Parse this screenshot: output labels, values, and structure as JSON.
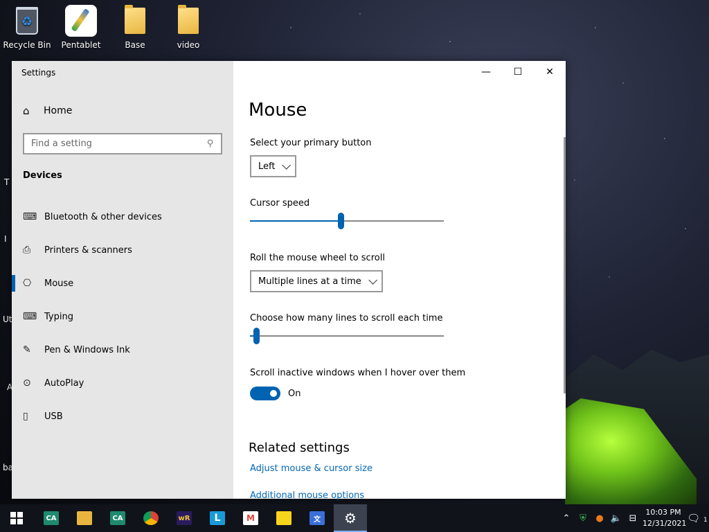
{
  "desktop": {
    "icons": [
      {
        "label": "Recycle Bin"
      },
      {
        "label": "Pentablet"
      },
      {
        "label": "Base"
      },
      {
        "label": "video"
      }
    ],
    "edge_letters": [
      "T",
      "I",
      "Ut",
      "A",
      "ba"
    ]
  },
  "window": {
    "title": "Settings",
    "controls": {
      "minimize": "—",
      "maximize": "☐",
      "close": "✕"
    }
  },
  "sidebar": {
    "home_label": "Home",
    "search_placeholder": "Find a setting",
    "section": "Devices",
    "items": [
      {
        "label": "Bluetooth & other devices",
        "icon": "bluetooth-devices-icon",
        "active": false
      },
      {
        "label": "Printers & scanners",
        "icon": "printer-icon",
        "active": false
      },
      {
        "label": "Mouse",
        "icon": "mouse-icon",
        "active": true
      },
      {
        "label": "Typing",
        "icon": "keyboard-icon",
        "active": false
      },
      {
        "label": "Pen & Windows Ink",
        "icon": "pen-icon",
        "active": false
      },
      {
        "label": "AutoPlay",
        "icon": "autoplay-icon",
        "active": false
      },
      {
        "label": "USB",
        "icon": "usb-icon",
        "active": false
      }
    ]
  },
  "main": {
    "title": "Mouse",
    "primary_button": {
      "label": "Select your primary button",
      "value": "Left"
    },
    "cursor_speed": {
      "label": "Cursor speed",
      "fraction": 0.47
    },
    "wheel_scroll": {
      "label": "Roll the mouse wheel to scroll",
      "value": "Multiple lines at a time"
    },
    "lines_scroll": {
      "label": "Choose how many lines to scroll each time",
      "fraction": 0.02
    },
    "inactive_scroll": {
      "label": "Scroll inactive windows when I hover over them",
      "state": "On"
    },
    "related": {
      "heading": "Related settings",
      "links": [
        "Adjust mouse & cursor size",
        "Additional mouse options"
      ]
    }
  },
  "taskbar": {
    "time": "10:03 PM",
    "date": "12/31/2021",
    "notification_count": "1",
    "accent": "#0063b1"
  }
}
